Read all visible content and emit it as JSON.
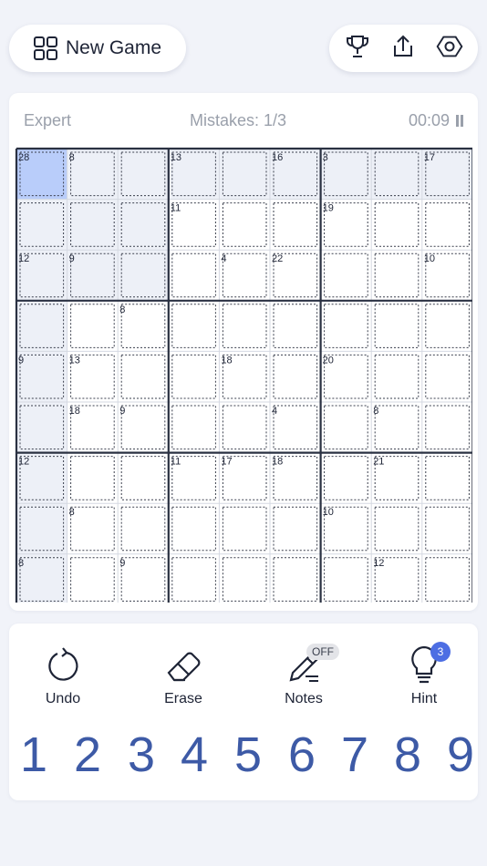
{
  "header": {
    "new_game_label": "New Game",
    "icons": [
      "grid-icon",
      "trophy-icon",
      "share-icon",
      "settings-icon"
    ]
  },
  "status": {
    "difficulty": "Expert",
    "mistakes": "Mistakes: 1/3",
    "timer": "00:09"
  },
  "board": {
    "selected_cell": [
      0,
      0
    ],
    "cage_sums": [
      {
        "cell": [
          0,
          0
        ],
        "sum": "28"
      },
      {
        "cell": [
          0,
          1
        ],
        "sum": "8"
      },
      {
        "cell": [
          0,
          3
        ],
        "sum": "13"
      },
      {
        "cell": [
          0,
          5
        ],
        "sum": "16"
      },
      {
        "cell": [
          0,
          6
        ],
        "sum": "3"
      },
      {
        "cell": [
          0,
          8
        ],
        "sum": "17"
      },
      {
        "cell": [
          1,
          3
        ],
        "sum": "11"
      },
      {
        "cell": [
          1,
          6
        ],
        "sum": "19"
      },
      {
        "cell": [
          2,
          0
        ],
        "sum": "12"
      },
      {
        "cell": [
          2,
          1
        ],
        "sum": "9"
      },
      {
        "cell": [
          2,
          4
        ],
        "sum": "4"
      },
      {
        "cell": [
          2,
          5
        ],
        "sum": "22"
      },
      {
        "cell": [
          2,
          8
        ],
        "sum": "10"
      },
      {
        "cell": [
          3,
          2
        ],
        "sum": "8"
      },
      {
        "cell": [
          4,
          0
        ],
        "sum": "9"
      },
      {
        "cell": [
          4,
          1
        ],
        "sum": "13"
      },
      {
        "cell": [
          4,
          4
        ],
        "sum": "18"
      },
      {
        "cell": [
          4,
          6
        ],
        "sum": "20"
      },
      {
        "cell": [
          5,
          1
        ],
        "sum": "18"
      },
      {
        "cell": [
          5,
          2
        ],
        "sum": "9"
      },
      {
        "cell": [
          5,
          5
        ],
        "sum": "4"
      },
      {
        "cell": [
          5,
          7
        ],
        "sum": "8"
      },
      {
        "cell": [
          6,
          0
        ],
        "sum": "12"
      },
      {
        "cell": [
          6,
          3
        ],
        "sum": "11"
      },
      {
        "cell": [
          6,
          4
        ],
        "sum": "17"
      },
      {
        "cell": [
          6,
          5
        ],
        "sum": "18"
      },
      {
        "cell": [
          6,
          7
        ],
        "sum": "21"
      },
      {
        "cell": [
          7,
          1
        ],
        "sum": "8"
      },
      {
        "cell": [
          7,
          6
        ],
        "sum": "10"
      },
      {
        "cell": [
          8,
          0
        ],
        "sum": "8"
      },
      {
        "cell": [
          8,
          2
        ],
        "sum": "9"
      },
      {
        "cell": [
          8,
          7
        ],
        "sum": "12"
      }
    ],
    "highlighted_cells": [
      [
        0,
        1
      ],
      [
        0,
        2
      ],
      [
        0,
        3
      ],
      [
        0,
        4
      ],
      [
        0,
        5
      ],
      [
        0,
        6
      ],
      [
        0,
        7
      ],
      [
        0,
        8
      ],
      [
        1,
        0
      ],
      [
        1,
        1
      ],
      [
        1,
        2
      ],
      [
        2,
        0
      ],
      [
        2,
        1
      ],
      [
        2,
        2
      ],
      [
        3,
        0
      ],
      [
        4,
        0
      ],
      [
        5,
        0
      ],
      [
        6,
        0
      ],
      [
        7,
        0
      ],
      [
        8,
        0
      ]
    ],
    "colors": {
      "selected": "#b9cdfa",
      "highlight": "#edf0f7",
      "thin_line": "#d5d9e2",
      "thick_line": "#2a3142",
      "cage_line": "#3a3f4d"
    }
  },
  "tools": {
    "undo_label": "Undo",
    "erase_label": "Erase",
    "notes_label": "Notes",
    "notes_state": "OFF",
    "hint_label": "Hint",
    "hint_count": "3"
  },
  "numpad": [
    "1",
    "2",
    "3",
    "4",
    "5",
    "6",
    "7",
    "8",
    "9"
  ],
  "theme": {
    "number_color": "#3d5aa6",
    "accent": "#4d6ee3"
  }
}
